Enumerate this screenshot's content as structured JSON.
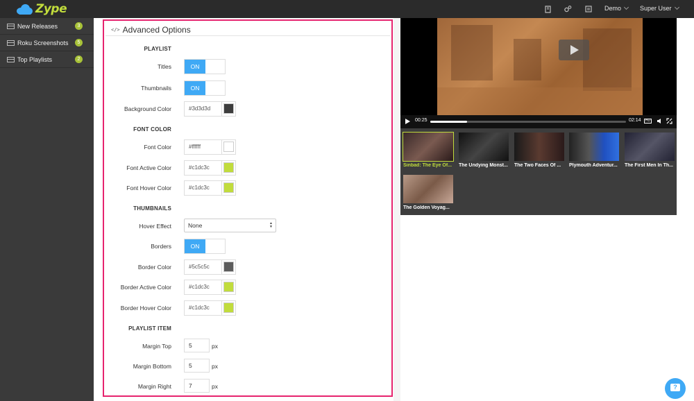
{
  "app": {
    "logo_text": "Zype"
  },
  "header": {
    "menus": [
      {
        "label": "Demo"
      },
      {
        "label": "Super User"
      }
    ],
    "icons": [
      "book-icon",
      "gears-icon",
      "news-icon"
    ]
  },
  "sidebar": {
    "items": [
      {
        "label": "New Releases",
        "count": "3"
      },
      {
        "label": "Roku Screenshots",
        "count": "5"
      },
      {
        "label": "Top Playlists",
        "count": "2"
      }
    ]
  },
  "panel": {
    "title": "Advanced Options",
    "icon_glyph": "</>",
    "sections": {
      "playlist": "PLAYLIST",
      "font_color": "FONT COLOR",
      "thumbnails": "THUMBNAILS",
      "playlist_item": "PLAYLIST ITEM"
    },
    "toggle_on_label": "ON",
    "playlist": {
      "titles": {
        "label": "Titles",
        "state": "ON"
      },
      "thumbnails": {
        "label": "Thumbnails",
        "state": "ON"
      },
      "background_color": {
        "label": "Background Color",
        "value": "#3d3d3d",
        "swatch": "#3d3d3d"
      }
    },
    "font_color": {
      "font": {
        "label": "Font Color",
        "value": "#ffffff",
        "swatch": "#ffffff"
      },
      "active": {
        "label": "Font Active Color",
        "value": "#c1dc3c",
        "swatch": "#c1dc3c"
      },
      "hover": {
        "label": "Font Hover Color",
        "value": "#c1dc3c",
        "swatch": "#c1dc3c"
      }
    },
    "thumbnails": {
      "hover_effect": {
        "label": "Hover Effect",
        "value": "None"
      },
      "borders": {
        "label": "Borders",
        "state": "ON"
      },
      "border_color": {
        "label": "Border Color",
        "value": "#5c5c5c",
        "swatch": "#5c5c5c"
      },
      "border_active": {
        "label": "Border Active Color",
        "value": "#c1dc3c",
        "swatch": "#c1dc3c"
      },
      "border_hover": {
        "label": "Border Hover Color",
        "value": "#c1dc3c",
        "swatch": "#c1dc3c"
      }
    },
    "playlist_item": {
      "margin_top": {
        "label": "Margin Top",
        "value": "5",
        "unit": "px"
      },
      "margin_bottom": {
        "label": "Margin Bottom",
        "value": "5",
        "unit": "px"
      },
      "margin_right": {
        "label": "Margin Right",
        "value": "7",
        "unit": "px"
      }
    }
  },
  "player": {
    "current_time": "00:25",
    "duration": "02:14",
    "progress": 0.187,
    "hd_label": "HD",
    "playlist": [
      {
        "title": "Sinbad: The Eye Of...",
        "active": true
      },
      {
        "title": "The Undying Monst...",
        "active": false
      },
      {
        "title": "The Two Faces Of ...",
        "active": false
      },
      {
        "title": "Plymouth Adventur...",
        "active": false
      },
      {
        "title": "The First Men In Th...",
        "active": false
      },
      {
        "title": "The Golden Voyag...",
        "active": false
      }
    ]
  },
  "colors": {
    "accent_blue": "#3fa9f5",
    "accent_green": "#c1dc3c",
    "highlight_border": "#e6236e"
  }
}
